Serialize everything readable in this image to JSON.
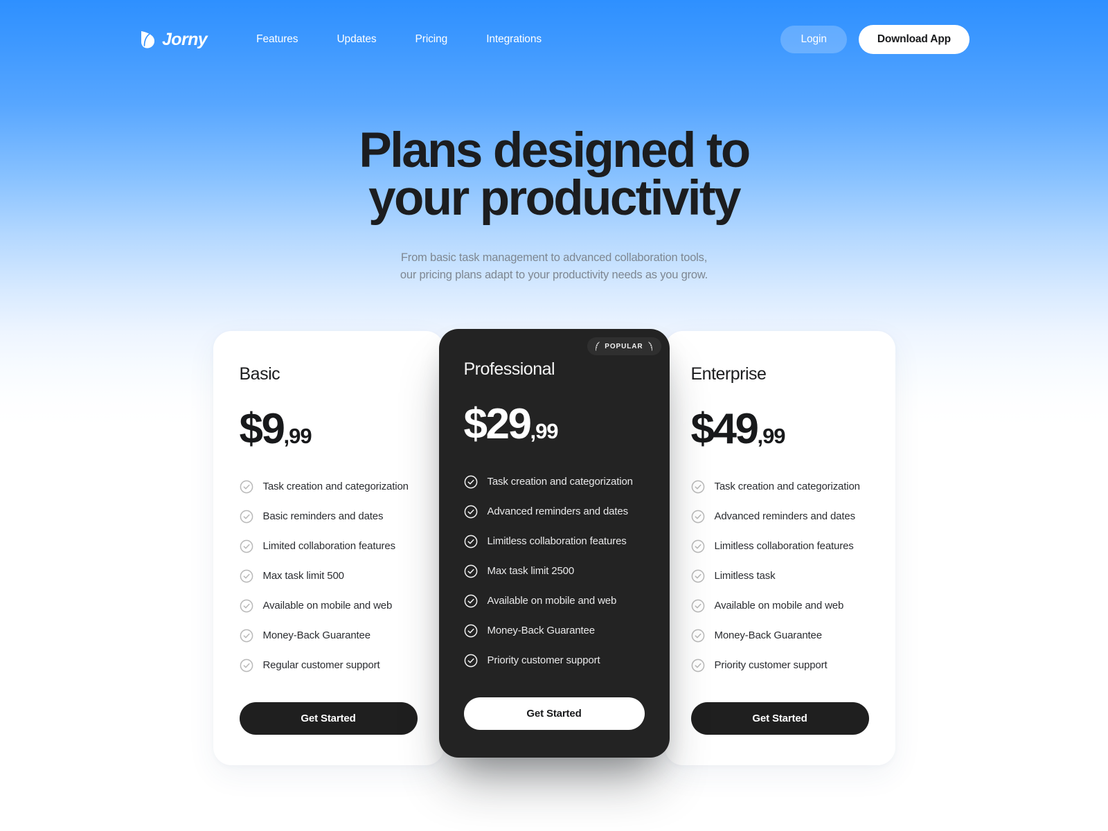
{
  "nav": {
    "logo_text": "Jorny",
    "logo_icon": "leaf-icon",
    "links": [
      {
        "label": "Features"
      },
      {
        "label": "Updates"
      },
      {
        "label": "Pricing"
      },
      {
        "label": "Integrations"
      }
    ],
    "login_label": "Login",
    "download_label": "Download App"
  },
  "hero": {
    "title_line1": "Plans designed to",
    "title_line2": "your productivity",
    "subtitle_line1": "From basic task management to advanced collaboration tools,",
    "subtitle_line2": "our pricing plans adapt to your productivity needs as you grow."
  },
  "colors": {
    "brand_blue": "#2e90ff",
    "dark_card": "#232323",
    "cta_dark": "#1f1f1f",
    "text_dark": "#1c1d1f",
    "text_muted": "#7e8791",
    "check_gray": "#bdbdbd"
  },
  "plans": [
    {
      "name": "Basic",
      "currency": "$",
      "amount": "9",
      "cents": ",99",
      "badge": null,
      "features": [
        "Task creation and categorization",
        "Basic reminders and dates",
        "Limited collaboration features",
        "Max task limit 500",
        "Available on mobile and web",
        "Money-Back Guarantee",
        "Regular customer support"
      ],
      "cta_label": "Get Started"
    },
    {
      "name": "Professional",
      "currency": "$",
      "amount": "29",
      "cents": ",99",
      "badge": "POPULAR",
      "features": [
        "Task creation and categorization",
        "Advanced reminders and dates",
        "Limitless collaboration features",
        "Max task limit 2500",
        "Available on mobile and web",
        "Money-Back Guarantee",
        "Priority customer support"
      ],
      "cta_label": "Get Started"
    },
    {
      "name": "Enterprise",
      "currency": "$",
      "amount": "49",
      "cents": ",99",
      "badge": null,
      "features": [
        "Task creation and categorization",
        "Advanced reminders and dates",
        "Limitless collaboration features",
        "Limitless task",
        "Available on mobile and web",
        "Money-Back Guarantee",
        "Priority customer support"
      ],
      "cta_label": "Get Started"
    }
  ]
}
